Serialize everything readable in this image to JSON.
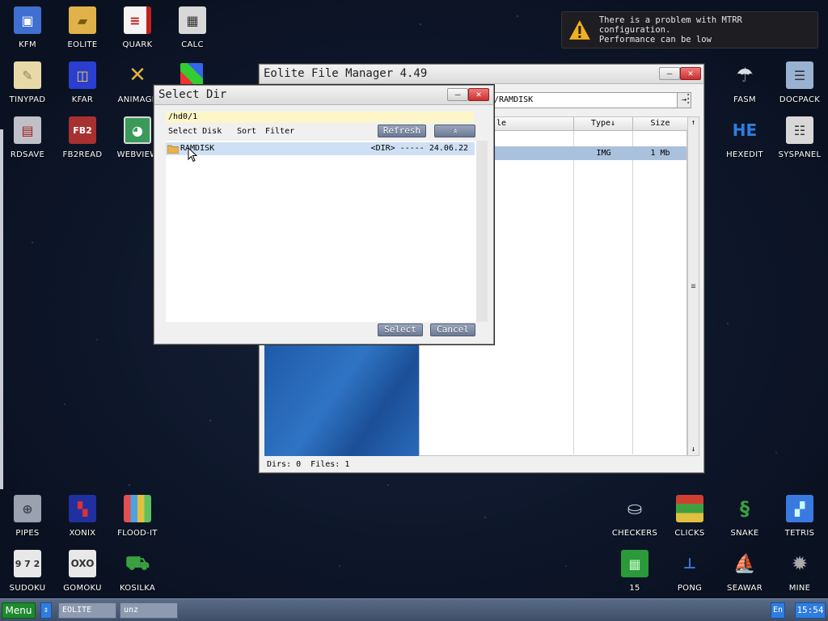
{
  "desktop": {
    "icons_left": [
      {
        "label": "KFM",
        "icon": "floppy-icon",
        "color": "#3f6fd0"
      },
      {
        "label": "EOLITE",
        "icon": "folder-icon",
        "color": "#e2b24a"
      },
      {
        "label": "QUARK",
        "icon": "book-icon",
        "color": "#c02020"
      },
      {
        "label": "CALC",
        "icon": "calculator-icon",
        "color": "#d8d8d8"
      },
      {
        "label": "TINYPAD",
        "icon": "notepad-icon",
        "color": "#e9d9a8"
      },
      {
        "label": "KFAR",
        "icon": "two-panel-icon",
        "color": "#2a3fd0"
      },
      {
        "label": "ANIMAGE",
        "icon": "pencil-ruler-icon",
        "color": "#e0b040"
      },
      {
        "label": "RDSAVE",
        "icon": "disk-save-icon",
        "color": "#c0c0c8"
      },
      {
        "label": "FB2READ",
        "icon": "fb2-book-icon",
        "color": "#a83030"
      },
      {
        "label": "WEBVIEW",
        "icon": "globe-map-icon",
        "color": "#3a9a5a"
      }
    ],
    "icons_right": [
      {
        "label": "FASM",
        "icon": "fasm-icon",
        "color": "#9aa4b2"
      },
      {
        "label": "DOCPACK",
        "icon": "docpack-icon",
        "color": "#9ab2d2"
      },
      {
        "label": "HEXEDIT",
        "icon": "hex-editor-icon",
        "color": "#1f66e0"
      },
      {
        "label": "SYSPANEL",
        "icon": "sliders-icon",
        "color": "#d8d8d8"
      }
    ],
    "games": [
      {
        "label": "PIPES",
        "icon": "pipes-icon",
        "color": "#9aa2b0"
      },
      {
        "label": "XONIX",
        "icon": "xonix-icon",
        "color": "#2030a0"
      },
      {
        "label": "FLOOD-IT",
        "icon": "flood-it-icon",
        "color": "#e05050"
      },
      {
        "label": "SUDOKU",
        "icon": "sudoku-icon",
        "color": "#e8e8e8"
      },
      {
        "label": "GOMOKU",
        "icon": "gomoku-icon",
        "color": "#e8e8e8"
      },
      {
        "label": "KOSILKA",
        "icon": "lawnmower-icon",
        "color": "#3aa040"
      },
      {
        "label": "CHECKERS",
        "icon": "checkers-icon",
        "color": "#c8d0d8"
      },
      {
        "label": "CLICKS",
        "icon": "clicks-icon",
        "color": "#d04030"
      },
      {
        "label": "SNAKE",
        "icon": "snake-icon",
        "color": "#3aa040"
      },
      {
        "label": "TETRIS",
        "icon": "tetris-icon",
        "color": "#3a7ae0"
      },
      {
        "label": "15",
        "icon": "fifteen-puzzle-icon",
        "color": "#2a9a3a"
      },
      {
        "label": "PONG",
        "icon": "pong-icon",
        "color": "#3a7ae0"
      },
      {
        "label": "SEAWAR",
        "icon": "seawar-icon",
        "color": "#c8c8c8"
      },
      {
        "label": "MINE",
        "icon": "mine-icon",
        "color": "#888888"
      }
    ]
  },
  "notification": {
    "line1": "There is a problem with MTRR configuration.",
    "line2": "Performance can be low"
  },
  "file_manager": {
    "title": "Eolite File Manager 4.49",
    "path": "/RAMDISK",
    "columns": {
      "name": "le",
      "type": "Type↓",
      "size": "Size"
    },
    "selected_row": {
      "type": "IMG",
      "size": "1 Mb"
    },
    "status": "Dirs: 0  Files: 1"
  },
  "select_dir": {
    "title": "Select Dir",
    "path": "/hd0/1",
    "menu": {
      "select_disk": "Select Disk",
      "sort": "Sort",
      "filter": "Filter"
    },
    "refresh": "Refresh",
    "up_symbol": "«",
    "row": {
      "name": "RAMDISK",
      "info": "<DIR> ----- 24.06.22"
    },
    "select": "Select",
    "cancel": "Cancel"
  },
  "taskbar": {
    "menu": "Menu",
    "arrow": "⇕",
    "tasks": [
      "EOLITE",
      "unz"
    ],
    "lang": "En",
    "clock": "15:54"
  },
  "colors": {
    "dialog_path_bg": "#fdf6c8",
    "selection": "#a9c1dc",
    "taskbar": "#4a5a76"
  }
}
